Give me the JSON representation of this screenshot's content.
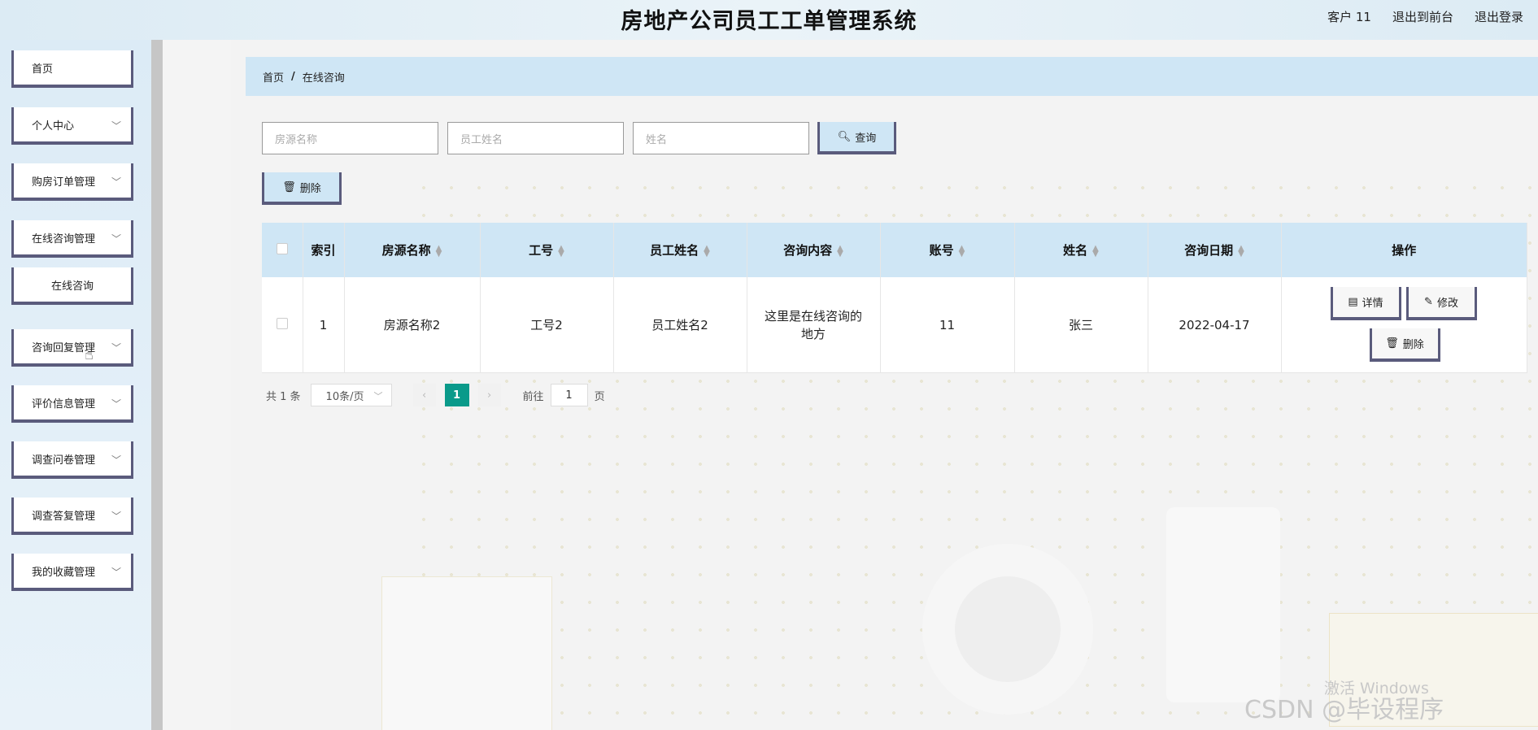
{
  "header": {
    "title": "房地产公司员工工单管理系统",
    "user": "客户 11",
    "to_front": "退出到前台",
    "logout": "退出登录"
  },
  "sidebar": {
    "items": [
      {
        "label": "首页"
      },
      {
        "label": "个人中心"
      },
      {
        "label": "购房订单管理"
      },
      {
        "label": "在线咨询管理"
      },
      {
        "label": "在线咨询"
      },
      {
        "label": "咨询回复管理"
      },
      {
        "label": "评价信息管理"
      },
      {
        "label": "调查问卷管理"
      },
      {
        "label": "调查答复管理"
      },
      {
        "label": "我的收藏管理"
      }
    ]
  },
  "breadcrumb": {
    "home": "首页",
    "sep": "/",
    "current": "在线咨询"
  },
  "search": {
    "house_placeholder": "房源名称",
    "staff_placeholder": "员工姓名",
    "name_placeholder": "姓名",
    "query_label": "查询",
    "delete_label": "删除"
  },
  "table": {
    "headers": [
      "索引",
      "房源名称",
      "工号",
      "员工姓名",
      "咨询内容",
      "账号",
      "姓名",
      "咨询日期",
      "操作"
    ],
    "rows": [
      {
        "index": "1",
        "house": "房源名称2",
        "staff_no": "工号2",
        "staff_name": "员工姓名2",
        "content": "这里是在线咨询的地方",
        "account": "11",
        "name": "张三",
        "date": "2022-04-17",
        "actions": {
          "detail": "详情",
          "edit": "修改",
          "delete": "删除"
        }
      }
    ]
  },
  "pager": {
    "total": "共 1 条",
    "page_size": "10条/页",
    "current_page": "1",
    "goto_prefix": "前往",
    "goto_value": "1",
    "goto_suffix": "页"
  },
  "watermark": {
    "line1": "激活 Windows",
    "line2": "CSDN @毕设程序"
  }
}
